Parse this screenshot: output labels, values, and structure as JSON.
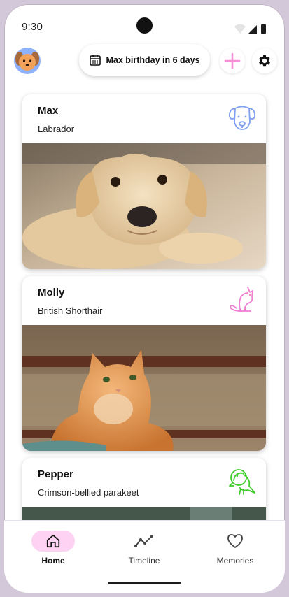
{
  "status": {
    "time": "9:30"
  },
  "header": {
    "avatar_icon": "dog-avatar-icon",
    "birthday_text": "Max birthday in 6 days",
    "calendar_icon": "calendar-icon",
    "add_icon": "plus-icon",
    "settings_icon": "gear-icon",
    "accent_color": "#f48fd6"
  },
  "pets": [
    {
      "name": "Max",
      "breed": "Labrador",
      "species_icon": "dog-icon",
      "icon_color": "#7f9ff0"
    },
    {
      "name": "Molly",
      "breed": "British Shorthair",
      "species_icon": "cat-icon",
      "icon_color": "#ef7fd2"
    },
    {
      "name": "Pepper",
      "breed": "Crimson-bellied parakeet",
      "species_icon": "bird-icon",
      "icon_color": "#3ecb2a"
    }
  ],
  "nav": {
    "items": [
      {
        "label": "Home",
        "icon": "home-icon",
        "active": true
      },
      {
        "label": "Timeline",
        "icon": "timeline-icon",
        "active": false
      },
      {
        "label": "Memories",
        "icon": "heart-icon",
        "active": false
      }
    ],
    "active_color": "#fdd2f2"
  }
}
